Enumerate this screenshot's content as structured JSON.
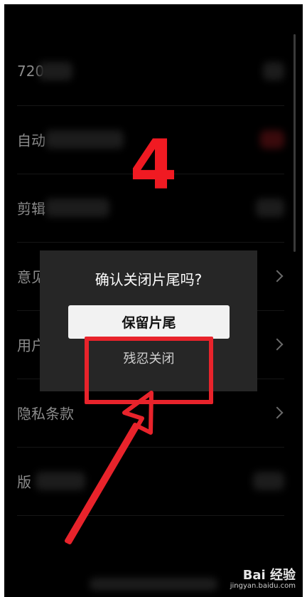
{
  "settings": {
    "items": [
      {
        "label": "720",
        "has_chevron": false
      },
      {
        "label": "自动",
        "has_chevron": false
      },
      {
        "label": "剪辑",
        "has_chevron": false
      },
      {
        "label": "意见",
        "has_chevron": true
      },
      {
        "label": "用户",
        "has_chevron": true
      },
      {
        "label": "隐私条款",
        "has_chevron": true
      },
      {
        "label": "版",
        "has_chevron": false
      }
    ]
  },
  "annotation": {
    "step_number": "4",
    "highlight_color": "#e8232b"
  },
  "dialog": {
    "title": "确认关闭片尾吗?",
    "keep_button_label": "保留片尾",
    "close_button_label": "残忍关闭"
  },
  "watermark": {
    "logo": "Bai 经验",
    "url": "jingyan.baidu.com"
  }
}
